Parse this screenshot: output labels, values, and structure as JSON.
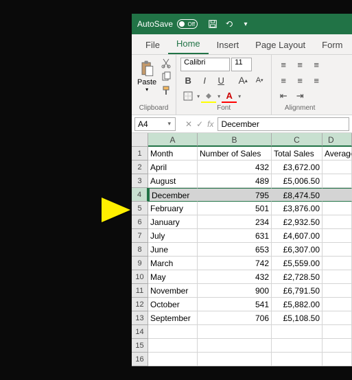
{
  "titlebar": {
    "autosave_label": "AutoSave",
    "autosave_state": "Off"
  },
  "tabs": [
    "File",
    "Home",
    "Insert",
    "Page Layout",
    "Form"
  ],
  "active_tab": "Home",
  "clipboard": {
    "paste_label": "Paste",
    "group_label": "Clipboard"
  },
  "font": {
    "name": "Calibri",
    "size": "11",
    "group_label": "Font",
    "bold": "B",
    "italic": "I",
    "underline": "U"
  },
  "alignment": {
    "group_label": "Alignment"
  },
  "namebox": "A4",
  "formula_bar_value": "December",
  "columns": [
    "A",
    "B",
    "C",
    "D"
  ],
  "selected_row_index": 3,
  "rows": [
    {
      "n": 1,
      "A": "Month",
      "B": "Number of Sales",
      "C": "Total Sales",
      "D": "Average"
    },
    {
      "n": 2,
      "A": "April",
      "B": "432",
      "C": "£3,672.00",
      "D": ""
    },
    {
      "n": 3,
      "A": "August",
      "B": "489",
      "C": "£5,006.50",
      "D": ""
    },
    {
      "n": 4,
      "A": "December",
      "B": "795",
      "C": "£8,474.50",
      "D": ""
    },
    {
      "n": 5,
      "A": "February",
      "B": "501",
      "C": "£3,876.00",
      "D": ""
    },
    {
      "n": 6,
      "A": "January",
      "B": "234",
      "C": "£2,932.50",
      "D": ""
    },
    {
      "n": 7,
      "A": "July",
      "B": "631",
      "C": "£4,607.00",
      "D": ""
    },
    {
      "n": 8,
      "A": "June",
      "B": "653",
      "C": "£6,307.00",
      "D": ""
    },
    {
      "n": 9,
      "A": "March",
      "B": "742",
      "C": "£5,559.00",
      "D": ""
    },
    {
      "n": 10,
      "A": "May",
      "B": "432",
      "C": "£2,728.50",
      "D": ""
    },
    {
      "n": 11,
      "A": "November",
      "B": "900",
      "C": "£6,791.50",
      "D": ""
    },
    {
      "n": 12,
      "A": "October",
      "B": "541",
      "C": "£5,882.00",
      "D": ""
    },
    {
      "n": 13,
      "A": "September",
      "B": "706",
      "C": "£5,108.50",
      "D": ""
    },
    {
      "n": 14,
      "A": "",
      "B": "",
      "C": "",
      "D": ""
    },
    {
      "n": 15,
      "A": "",
      "B": "",
      "C": "",
      "D": ""
    },
    {
      "n": 16,
      "A": "",
      "B": "",
      "C": "",
      "D": ""
    }
  ]
}
